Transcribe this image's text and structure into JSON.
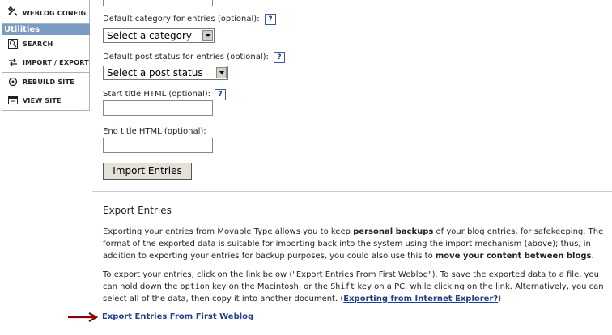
{
  "sidebar": {
    "weblog_config_label": "WEBLOG CONFIG",
    "utilities_heading": "Utilities",
    "items": [
      {
        "label": "SEARCH",
        "icon": "search-icon"
      },
      {
        "label": "IMPORT / EXPORT",
        "icon": "import-export-icon"
      },
      {
        "label": "REBUILD SITE",
        "icon": "rebuild-icon"
      },
      {
        "label": "VIEW SITE",
        "icon": "view-site-icon"
      }
    ]
  },
  "import": {
    "default_category_label": "Default category for entries (optional):",
    "default_category_value": "Select a category",
    "default_status_label": "Default post status for entries (optional):",
    "default_status_value": "Select a post status",
    "start_title_label": "Start title HTML (optional):",
    "end_title_label": "End title HTML (optional):",
    "help_glyph": "?",
    "import_button": "Import Entries"
  },
  "export": {
    "title": "Export Entries",
    "p1_a": "Exporting your entries from Movable Type allows you to keep ",
    "p1_b": "personal backups",
    "p1_c": " of your blog entries, for safekeeping. The format of the exported data is suitable for importing back into the system using the import mechanism (above); thus, in addition to exporting your entries for backup purposes, you could also use this to ",
    "p1_d": "move your content between blogs",
    "p1_e": ".",
    "p2_a": "To export your entries, click on the link below (\"Export Entries From First Weblog\"). To save the exported data to a file, you can hold down the ",
    "p2_option": "option",
    "p2_b": " key on the Macintosh, or the ",
    "p2_shift": "Shift",
    "p2_c": " key on a PC, while clicking on the link. Alternatively, you can select all of the data, then copy it into another document. (",
    "p2_link": "Exporting from Internet Explorer?",
    "p2_d": ")",
    "export_link": "Export Entries From First Weblog"
  },
  "colors": {
    "link": "#1f3f8c",
    "sidebar_heading_bg": "#7b9cc2",
    "arrow": "#8b0000"
  }
}
